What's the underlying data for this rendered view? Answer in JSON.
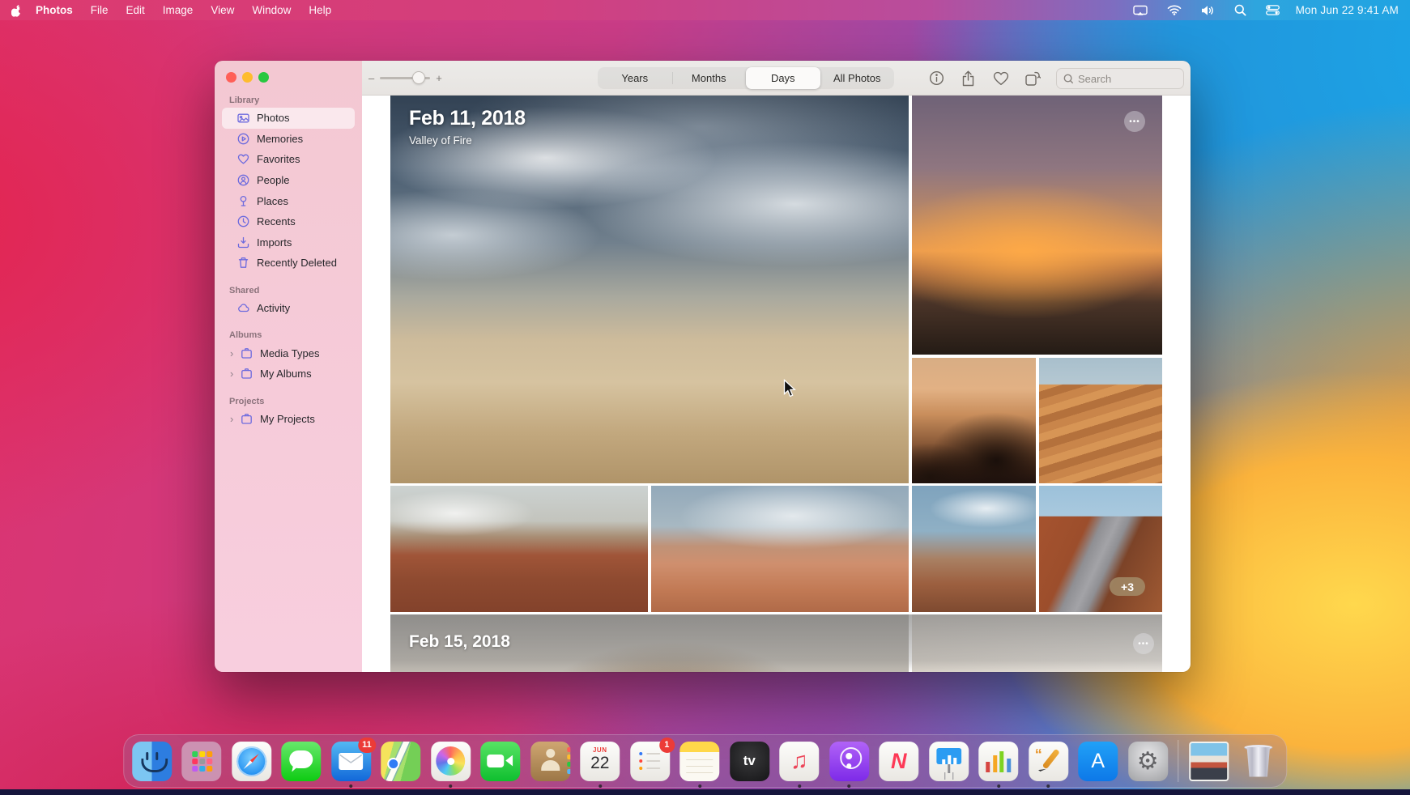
{
  "menu_bar": {
    "app_name": "Photos",
    "menus": [
      "File",
      "Edit",
      "Image",
      "View",
      "Window",
      "Help"
    ],
    "status_icons": [
      "display-icon",
      "wifi-icon",
      "volume-icon",
      "spotlight-icon",
      "control-center-icon"
    ],
    "clock": "Mon Jun 22 9:41 AM"
  },
  "window": {
    "sidebar": {
      "sections": [
        {
          "title": "Library",
          "items": [
            {
              "label": "Photos",
              "icon": "photos-icon",
              "selected": true
            },
            {
              "label": "Memories",
              "icon": "memories-icon"
            },
            {
              "label": "Favorites",
              "icon": "heart-icon"
            },
            {
              "label": "People",
              "icon": "people-icon"
            },
            {
              "label": "Places",
              "icon": "pin-icon"
            },
            {
              "label": "Recents",
              "icon": "clock-icon"
            },
            {
              "label": "Imports",
              "icon": "import-icon"
            },
            {
              "label": "Recently Deleted",
              "icon": "trash-icon"
            }
          ]
        },
        {
          "title": "Shared",
          "items": [
            {
              "label": "Activity",
              "icon": "cloud-icon"
            }
          ]
        },
        {
          "title": "Albums",
          "items": [
            {
              "label": "Media Types",
              "icon": "album-icon",
              "chevron": "›"
            },
            {
              "label": "My Albums",
              "icon": "album-icon",
              "chevron": "›"
            }
          ]
        },
        {
          "title": "Projects",
          "items": [
            {
              "label": "My Projects",
              "icon": "album-icon",
              "chevron": "›"
            }
          ]
        }
      ]
    },
    "toolbar": {
      "zoom_out": "–",
      "zoom_in": "+",
      "segments": [
        "Years",
        "Months",
        "Days",
        "All Photos"
      ],
      "selected_segment": "Days",
      "search_placeholder": "Search"
    },
    "content": {
      "groups": [
        {
          "date": "Feb 11, 2018",
          "subtitle": "Valley of Fire",
          "more": "•••",
          "overflow_badge": "+3"
        },
        {
          "date": "Feb 15, 2018",
          "more": "•••"
        }
      ]
    }
  },
  "dock": {
    "mail_badge": "11",
    "reminders_badge": "1",
    "calendar_month": "JUN",
    "calendar_day": "22",
    "tv_label": "tv",
    "music_glyph": "♫",
    "news_letter": "N",
    "pages_quote": "“",
    "appstore_letter": "A",
    "prefs_glyph": "⚙",
    "apps": [
      "finder-icon",
      "launchpad-icon",
      "safari-icon",
      "messages-icon",
      "mail-icon",
      "maps-icon",
      "photos-app-icon",
      "facetime-icon",
      "contacts-icon",
      "calendar-icon",
      "reminders-icon",
      "notes-icon",
      "tv-icon",
      "music-icon",
      "podcasts-icon",
      "news-icon",
      "keynote-icon",
      "numbers-icon",
      "pages-icon",
      "app-store-icon",
      "system-preferences-icon",
      "image-file-icon",
      "trash-icon"
    ]
  }
}
